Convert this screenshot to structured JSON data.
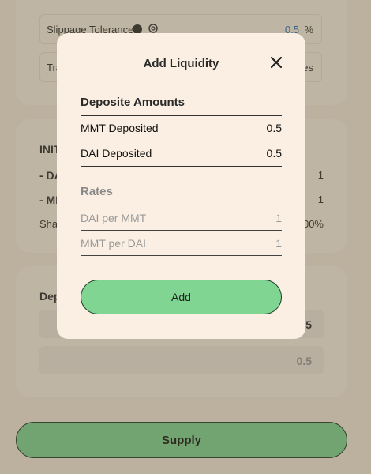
{
  "background": {
    "settings": {
      "slippage_label": "Slippage Tolerance",
      "slippage_value": "0.5",
      "slippage_unit": "%",
      "trade_partial": "Tra",
      "trade_value_partial": "es"
    },
    "initial": {
      "title_partial": "INIT",
      "row1_label": "- DA",
      "row1_value": "1",
      "row2_label": "- MM",
      "row2_value": "1",
      "share_label": "Sha",
      "share_value": "00%"
    },
    "deposit": {
      "title_partial": "Dep",
      "field1_value": "5",
      "field2_value": "0.5"
    },
    "supply_button": "Supply"
  },
  "modal": {
    "title": "Add Liquidity",
    "deposit_section_title": "Deposite Amounts",
    "deposits": [
      {
        "label": "MMT Deposited",
        "value": "0.5"
      },
      {
        "label": "DAI Deposited",
        "value": "0.5"
      }
    ],
    "rates_section_title": "Rates",
    "rates": [
      {
        "label": "DAI per MMT",
        "value": "1"
      },
      {
        "label": "MMT per DAI",
        "value": "1"
      }
    ],
    "add_button": "Add"
  },
  "colors": {
    "accent": "#7fd591",
    "background": "#f6eadb",
    "modal": "#faefe2",
    "overlay": "#5f553c"
  }
}
